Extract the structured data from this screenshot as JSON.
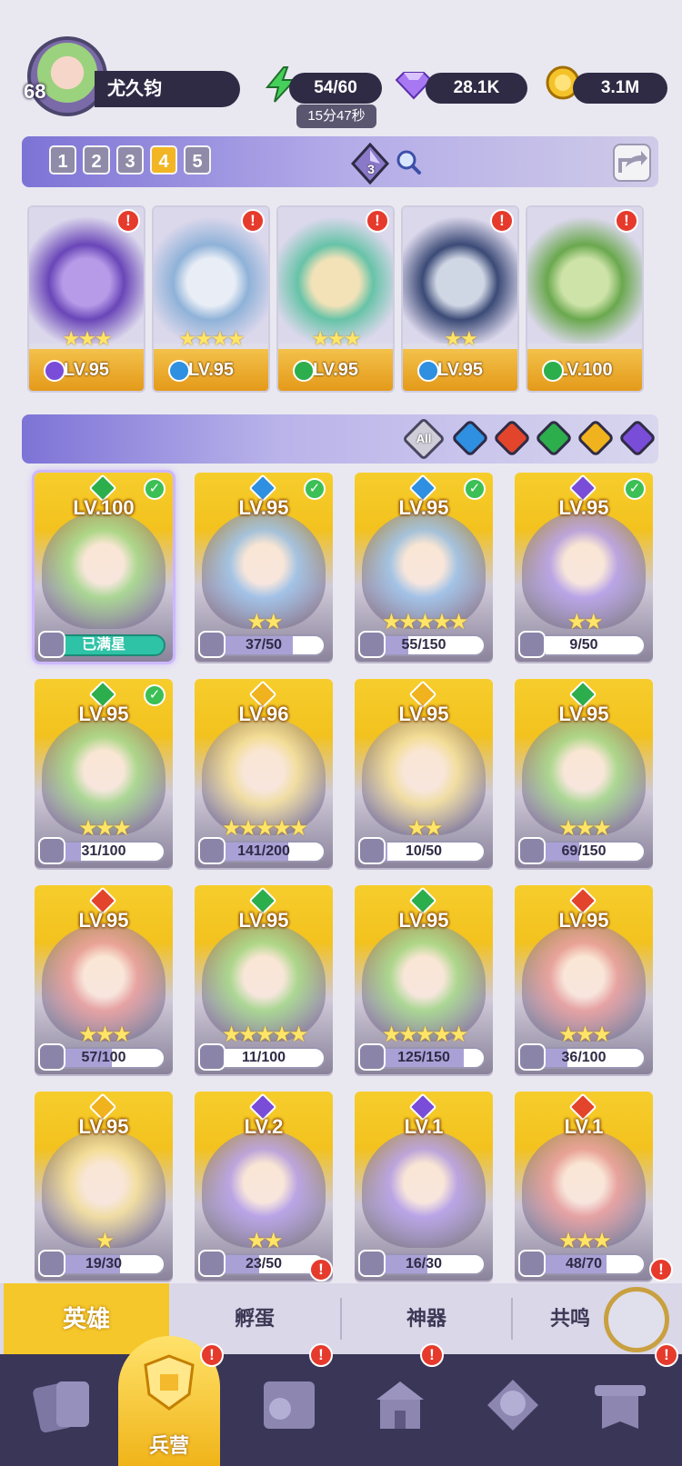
{
  "player": {
    "level": "68",
    "name": "尤久钧"
  },
  "resources": {
    "stamina": "54/60",
    "stamina_timer": "15分47秒",
    "gems": "28.1K",
    "gold": "3.1M"
  },
  "team_tabs": [
    "1",
    "2",
    "3",
    "4",
    "5"
  ],
  "active_team": "4",
  "crystal_count": "3",
  "colors": {
    "water": "#2f8fe0",
    "fire": "#e2452c",
    "nature": "#2dae4c",
    "light": "#f0b21d",
    "dark": "#7a4dd8",
    "gold": "#f4c32a"
  },
  "team_slots": [
    {
      "level": "LV.95",
      "element": "dark",
      "stars": "★★★",
      "alert": "!"
    },
    {
      "level": "LV.95",
      "element": "water",
      "stars": "★★★★",
      "alert": "!"
    },
    {
      "level": "LV.95",
      "element": "nature",
      "stars": "★★★",
      "alert": "!"
    },
    {
      "level": "LV.95",
      "element": "water",
      "stars": "★★",
      "alert": "!"
    },
    {
      "level": "LV.100",
      "element": "nature",
      "stars": "",
      "alert": "!"
    }
  ],
  "filters": {
    "all_label": "All",
    "elements": [
      "water",
      "fire",
      "nature",
      "light",
      "dark"
    ]
  },
  "heroes": [
    {
      "level": "LV.100",
      "element": "nature",
      "checked": true,
      "stars": "",
      "progress_text": "已满星",
      "fill": 1.0,
      "maxed": true
    },
    {
      "level": "LV.95",
      "element": "water",
      "checked": true,
      "stars": "★★",
      "progress_text": "37/50",
      "fill": 0.74
    },
    {
      "level": "LV.95",
      "element": "water",
      "checked": true,
      "stars": "★★★★★",
      "progress_text": "55/150",
      "fill": 0.37
    },
    {
      "level": "LV.95",
      "element": "dark",
      "checked": true,
      "stars": "★★",
      "progress_text": "9/50",
      "fill": 0.18
    },
    {
      "level": "LV.95",
      "element": "nature",
      "checked": true,
      "stars": "★★★",
      "progress_text": "31/100",
      "fill": 0.31
    },
    {
      "level": "LV.96",
      "element": "light",
      "checked": false,
      "stars": "★★★★★",
      "progress_text": "141/200",
      "fill": 0.705
    },
    {
      "level": "LV.95",
      "element": "light",
      "checked": false,
      "stars": "★★",
      "progress_text": "10/50",
      "fill": 0.2
    },
    {
      "level": "LV.95",
      "element": "nature",
      "checked": false,
      "stars": "★★★",
      "progress_text": "69/150",
      "fill": 0.46
    },
    {
      "level": "LV.95",
      "element": "fire",
      "checked": false,
      "stars": "★★★",
      "progress_text": "57/100",
      "fill": 0.57
    },
    {
      "level": "LV.95",
      "element": "nature",
      "checked": false,
      "stars": "★★★★★",
      "progress_text": "11/100",
      "fill": 0.11
    },
    {
      "level": "LV.95",
      "element": "nature",
      "checked": false,
      "stars": "★★★★★",
      "progress_text": "125/150",
      "fill": 0.833
    },
    {
      "level": "LV.95",
      "element": "fire",
      "checked": false,
      "stars": "★★★",
      "progress_text": "36/100",
      "fill": 0.36
    },
    {
      "level": "LV.95",
      "element": "light",
      "checked": false,
      "stars": "★",
      "progress_text": "19/30",
      "fill": 0.633
    },
    {
      "level": "LV.2",
      "element": "dark",
      "checked": false,
      "stars": "★★",
      "progress_text": "23/50",
      "fill": 0.46
    },
    {
      "level": "LV.1",
      "element": "dark",
      "checked": false,
      "stars": "",
      "progress_text": "16/30",
      "fill": 0.533
    },
    {
      "level": "LV.1",
      "element": "fire",
      "checked": false,
      "stars": "★★★",
      "progress_text": "48/70",
      "fill": 0.686
    }
  ],
  "tabs": {
    "heroes": "英雄",
    "hatch": "孵蛋",
    "artifacts": "神器",
    "resonance": "共鸣"
  },
  "nav": {
    "barracks": "兵营"
  },
  "alert_mark": "!"
}
